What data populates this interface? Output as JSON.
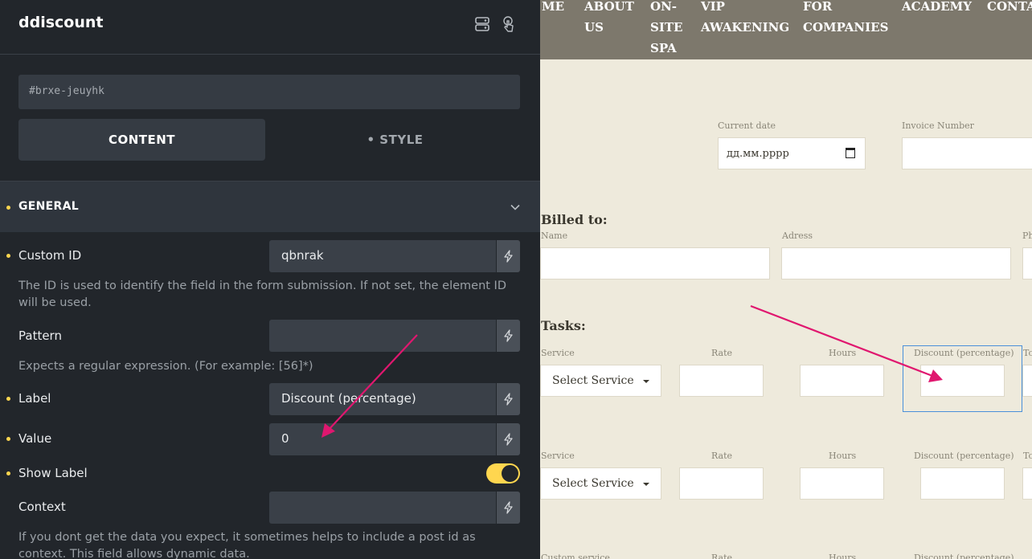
{
  "panel": {
    "title": "ddiscount",
    "css_id": "#brxe-jeuyhk",
    "tabs": {
      "content": "CONTENT",
      "style": "• STYLE"
    },
    "section": "GENERAL",
    "fields": {
      "custom_id": {
        "label": "Custom ID",
        "value": "qbnrak",
        "help": "The ID is used to identify the field in the form submission. If not set, the element ID will be used."
      },
      "pattern": {
        "label": "Pattern",
        "value": "",
        "help": "Expects a regular expression. (For example: [56]*)"
      },
      "label": {
        "label": "Label",
        "value": "Discount (percentage)"
      },
      "value": {
        "label": "Value",
        "value": "0"
      },
      "show_label": {
        "label": "Show Label",
        "on": true
      },
      "context": {
        "label": "Context",
        "value": "",
        "help": "If you dont get the data you expect, it sometimes helps to include a post id as context. This field allows dynamic data."
      }
    }
  },
  "preview": {
    "nav": [
      "ME",
      "ABOUT US",
      "ON-SITE SPA",
      "VIP AWAKENING",
      "FOR COMPANIES",
      "ACADEMY",
      "CONTA"
    ],
    "current_date_label": "Current date",
    "date_placeholder": "дд.мм.рррр",
    "invoice_label": "Invoice Number",
    "billed_to": "Billed to:",
    "name_label": "Name",
    "address_label": "Adress",
    "phone_label": "Ph",
    "tasks": "Tasks:",
    "service_label": "Service",
    "rate_label": "Rate",
    "hours_label": "Hours",
    "discount_label": "Discount (percentage)",
    "total_label": "To",
    "select_service": "Select Service",
    "custom_service_label": "Custom service"
  },
  "colors": {
    "accent": "#ffd64f",
    "panel_bg": "#22262b",
    "preview_bg": "#eeeadc",
    "nav_bg": "#7d786c",
    "annotation_arrow": "#e0176f",
    "selection_outline": "#4a90d9"
  }
}
